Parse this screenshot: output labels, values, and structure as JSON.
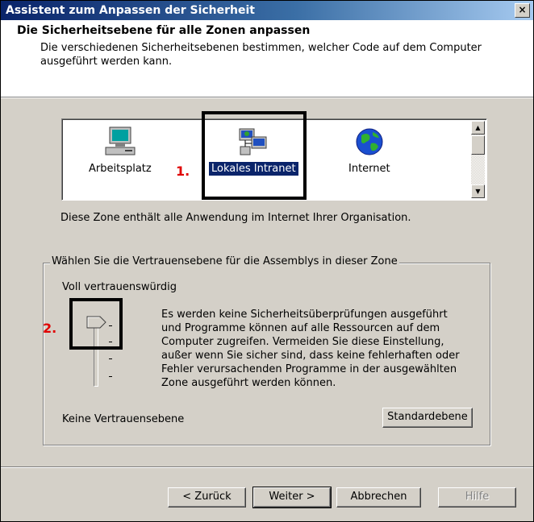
{
  "window": {
    "title": "Assistent zum Anpassen der Sicherheit",
    "close_glyph": "×"
  },
  "header": {
    "title": "Die Sicherheitsebene für alle Zonen anpassen",
    "subtitle": "Die verschiedenen Sicherheitsebenen bestimmen, welcher Code auf dem Computer ausgeführt werden kann."
  },
  "zones": {
    "items": [
      {
        "label": "Arbeitsplatz",
        "icon": "computer-icon",
        "selected": false
      },
      {
        "label": "Lokales Intranet",
        "icon": "network-icon",
        "selected": true
      },
      {
        "label": "Internet",
        "icon": "globe-icon",
        "selected": false
      }
    ],
    "description": "Diese Zone enthält alle Anwendung im Internet Ihrer Organisation."
  },
  "annotations": {
    "step1": "1.",
    "step2": "2.",
    "color": "#e00000"
  },
  "trust": {
    "group_label": "Wählen Sie die Vertrauensebene für die Assemblys in dieser Zone",
    "top_label": "Voll vertrauenswürdig",
    "bottom_label": "Keine Vertrauensebene",
    "level_description": "Es werden keine Sicherheitsüberprüfungen ausgeführt und Programme können auf alle Ressourcen auf dem Computer zugreifen. Vermeiden Sie diese Einstellung, außer wenn Sie sicher sind, dass keine fehlerhaften oder Fehler verursachenden Programme in der ausgewählten Zone ausgeführt werden können.",
    "default_button": "Standardebene",
    "slider_level": "Voll vertrauenswürdig"
  },
  "footer": {
    "back": "< Zurück",
    "next": "Weiter >",
    "cancel": "Abbrechen",
    "help": "Hilfe"
  },
  "colors": {
    "titlebar_start": "#0a246a",
    "titlebar_end": "#a6caf0",
    "face": "#d4d0c8",
    "selection": "#0a246a"
  }
}
